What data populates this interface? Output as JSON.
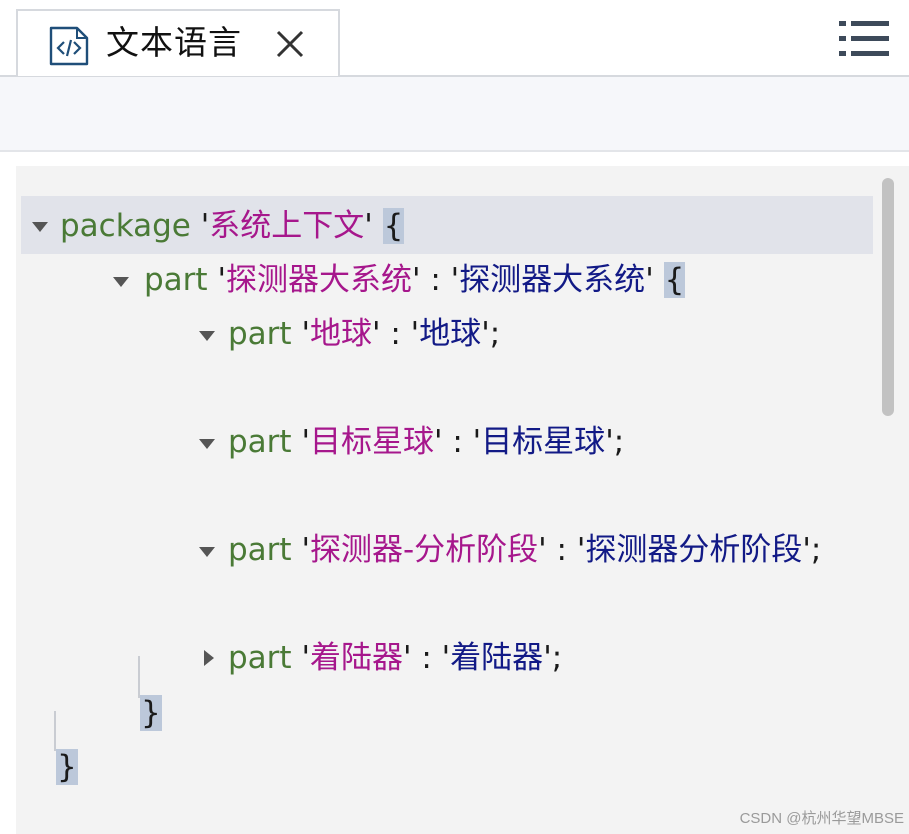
{
  "tab": {
    "title": "文本语言",
    "icon": "code-file-icon",
    "close_icon": "close-icon"
  },
  "menu_icon": "list-menu-icon",
  "code": {
    "line1": {
      "keyword": "package",
      "q1": "'",
      "name": "系统上下文",
      "q2": "'",
      "space": " ",
      "brace": "{"
    },
    "line2": {
      "keyword": "part",
      "q1": "'",
      "name": "探测器大系统",
      "q2": "'",
      "colon": " : ",
      "q3": "'",
      "type": "探测器大系统",
      "q4": "'",
      "space": " ",
      "brace": "{"
    },
    "line3": {
      "keyword": "part",
      "q1": "'",
      "name": "地球",
      "q2": "'",
      "colon": " : ",
      "q3": "'",
      "type": "地球",
      "q4": "'",
      "semi": ";"
    },
    "line4": {
      "keyword": "part",
      "q1": "'",
      "name": "目标星球",
      "q2": "'",
      "colon": " : ",
      "q3": "'",
      "type": "目标星球",
      "q4": "'",
      "semi": ";"
    },
    "line5": {
      "keyword": "part",
      "q1": "'",
      "name": "探测器-分析阶段",
      "q2": "'",
      "colon": " : ",
      "q3": "'",
      "type": "探测器分析阶段",
      "q4": "'",
      "semi": ";"
    },
    "line6": {
      "keyword": "part",
      "q1": "'",
      "name": "着陆器",
      "q2": "'",
      "colon": " : ",
      "q3": "'",
      "type": "着陆器",
      "q4": "'",
      "semi": ";"
    },
    "close_inner": "}",
    "close_outer": "}"
  },
  "colors": {
    "keyword": "#4a7a36",
    "name": "#a6178c",
    "type": "#121a86",
    "bracket_highlight": "#bcc8da",
    "line_highlight": "#e1e3ea"
  },
  "watermark": "CSDN @杭州华望MBSE"
}
